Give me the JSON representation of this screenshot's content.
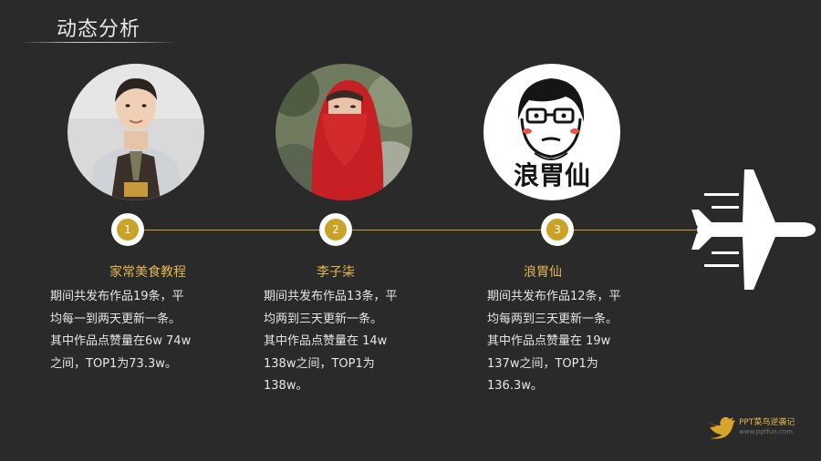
{
  "title": "动态分析",
  "items": [
    {
      "number": "1",
      "name": "家常美食教程",
      "lines": [
        "期间共发布作品19条，平",
        "均每一到两天更新一条。",
        "其中作品点赞量在6w 74w",
        "之间，TOP1为73.3w。"
      ],
      "avatar": "photo-man-apron"
    },
    {
      "number": "2",
      "name": "李子柒",
      "lines": [
        "期间共发布作品13条，平",
        "均两到三天更新一条。",
        "其中作品点赞量在 14w",
        "138w之间，TOP1为138w。"
      ],
      "avatar": "photo-woman-red-veil"
    },
    {
      "number": "3",
      "name": "浪胃仙",
      "lines": [
        "期间共发布作品12条，平",
        "均每两到三天更新一条。",
        "其中作品点赞量在 19w",
        "137w之间，TOP1为 136.3w。"
      ],
      "avatar": "cartoon-face-logo",
      "avatar_text": "浪胃仙"
    }
  ],
  "brand": {
    "name": "PPT菜鸟逆袭记",
    "url": "www.pptfun.com",
    "icon": "bird-icon"
  },
  "decor": {
    "plane_icon": "airplane-icon"
  },
  "colors": {
    "background": "#2a2a2a",
    "accent": "#c9a227",
    "name": "#e3b84a",
    "text": "#e6e6e6"
  }
}
